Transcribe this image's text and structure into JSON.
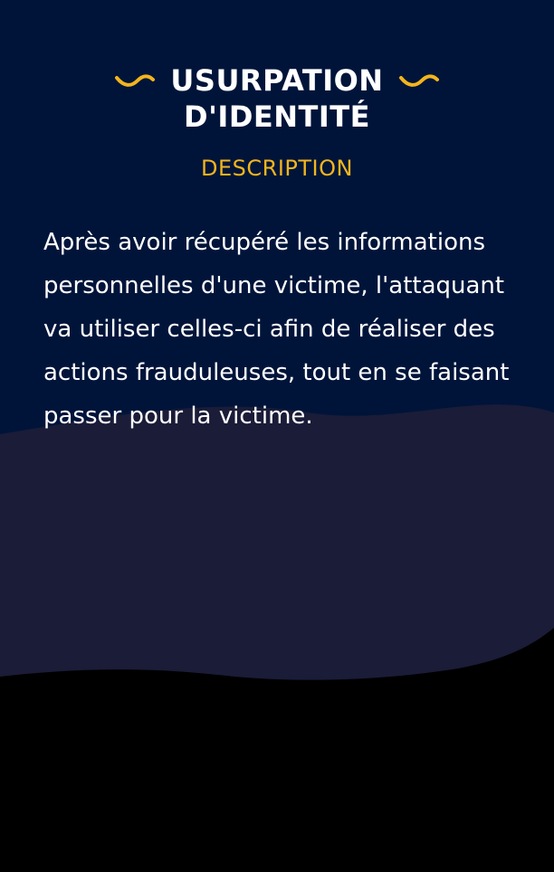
{
  "card": {
    "title_line1": "USURPATION",
    "title_line2": "D'IDENTITÉ",
    "subtitle": "DESCRIPTION",
    "description": "Après avoir récupéré les informations personnelles d'une victime, l'attaquant va utiliser celles-ci afin de réaliser des actions frauduleuses, tout en se faisant passer pour la victime."
  },
  "colors": {
    "background_top": "#00143a",
    "wave_middle": "#1a1c38",
    "wave_bottom": "#000000",
    "accent": "#f2b51d",
    "text": "#ffffff"
  },
  "icons": {
    "title_left_decoration": "squiggle-icon",
    "title_right_decoration": "squiggle-icon"
  }
}
